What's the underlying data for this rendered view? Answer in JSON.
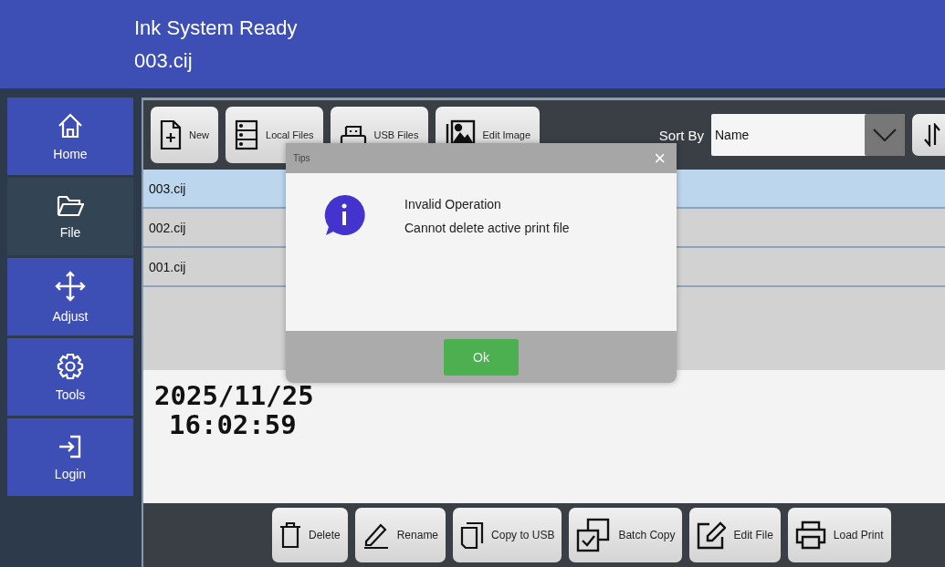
{
  "header": {
    "status": "Ink System Ready",
    "file": "003.cij"
  },
  "sidebar": {
    "items": [
      {
        "label": "Home",
        "selected": false
      },
      {
        "label": "File",
        "selected": true
      },
      {
        "label": "Adjust",
        "selected": false
      },
      {
        "label": "Tools",
        "selected": false
      },
      {
        "label": "Login",
        "selected": false
      }
    ]
  },
  "toolbar": {
    "buttons": [
      {
        "label": "New"
      },
      {
        "label": "Local Files"
      },
      {
        "label": "USB Files"
      },
      {
        "label": "Edit Image"
      }
    ],
    "sort_label": "Sort By",
    "sort_value": "Name"
  },
  "files": [
    {
      "name": "003.cij",
      "selected": true
    },
    {
      "name": "002.cij",
      "selected": false
    },
    {
      "name": "001.cij",
      "selected": false
    }
  ],
  "preview": {
    "date": "2025/11/25",
    "time": "16:02:59"
  },
  "actions": [
    {
      "label": "Delete"
    },
    {
      "label": "Rename"
    },
    {
      "label": "Copy to USB"
    },
    {
      "label": "Batch Copy"
    },
    {
      "label": "Edit File"
    },
    {
      "label": "Load Print"
    }
  ],
  "dialog": {
    "title": "Tips",
    "close": "×",
    "heading": "Invalid Operation",
    "message": "Cannot delete active print file",
    "ok": "Ok"
  }
}
